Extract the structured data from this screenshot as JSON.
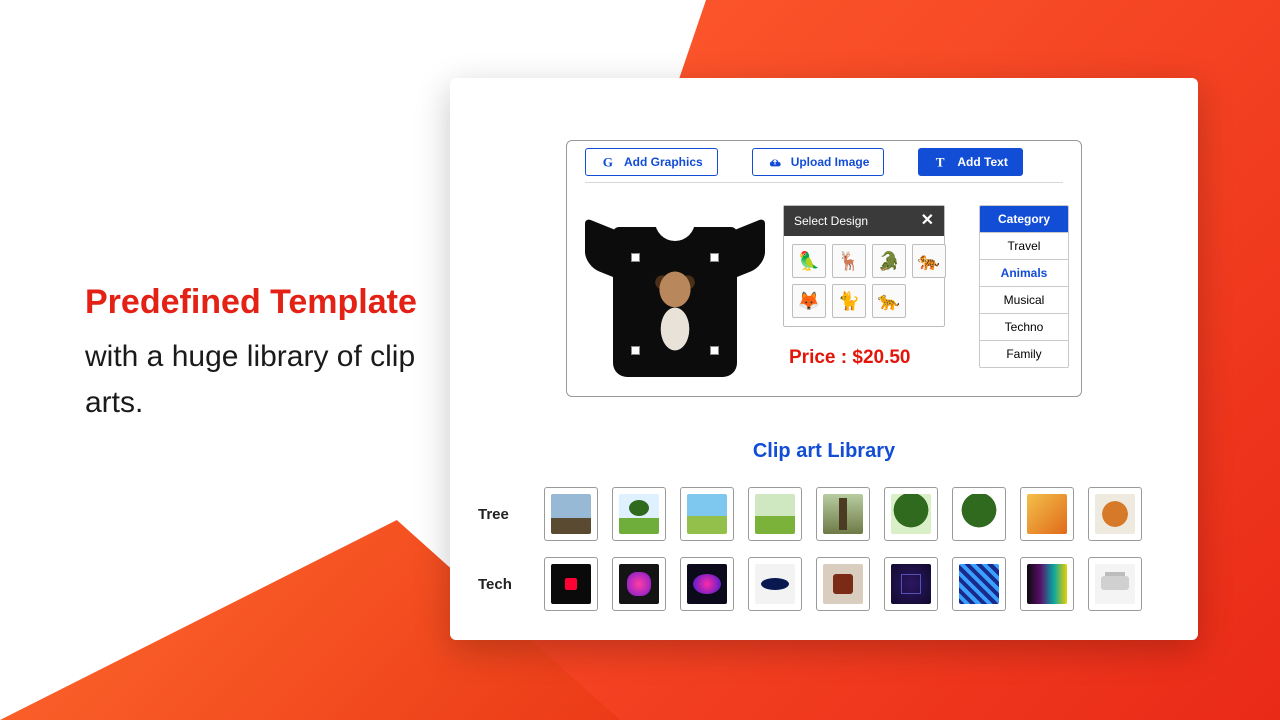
{
  "hero": {
    "line1": "Predefined Template",
    "line2": "with a huge library of clip arts."
  },
  "toolbar": {
    "graphics_label": "Add Graphics",
    "upload_label": "Upload Image",
    "text_label": "Add Text"
  },
  "popover": {
    "title": "Select Design",
    "thumbs": [
      "parrot",
      "deer",
      "crocodile",
      "tiger",
      "fox",
      "cat",
      "leopard"
    ]
  },
  "price": {
    "label": "Price : ",
    "value": "$20.50"
  },
  "category": {
    "header": "Category",
    "items": [
      "Travel",
      "Animals",
      "Musical",
      "Techno",
      "Family"
    ],
    "active": "Animals"
  },
  "library": {
    "title": "Clip art Library",
    "rows": [
      {
        "label": "Tree",
        "thumbs": [
          "tree-bare",
          "tree-green",
          "tree-field",
          "tree-meadow",
          "tree-path",
          "tree-photo",
          "tree-clip",
          "tree-autumn",
          "tree-bonsai"
        ]
      },
      {
        "label": "Tech",
        "thumbs": [
          "youtube",
          "instagram",
          "orb",
          "disc",
          "retro",
          "hologram",
          "circuits",
          "spectrum",
          "drone"
        ]
      }
    ]
  },
  "emoji": {
    "parrot": "🦜",
    "deer": "🦌",
    "crocodile": "🐊",
    "tiger": "🐅",
    "fox": "🦊",
    "cat": "🐈",
    "leopard": "🐆"
  }
}
